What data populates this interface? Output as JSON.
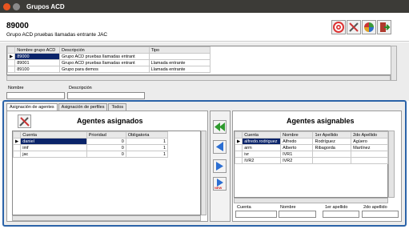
{
  "window": {
    "title": "Grupos ACD"
  },
  "header": {
    "code": "89000",
    "description": "Grupo ACD pruebas llamadas entrante JAC"
  },
  "groups_table": {
    "columns": [
      "Nombre grupo ACD",
      "Descripción",
      "Tipo"
    ],
    "rows": [
      [
        "89000",
        "Grupo ACD pruebas llamadas entrant",
        ""
      ],
      [
        "89001",
        "Grupo ACD pruebas llamadas entrant",
        "Llamada entrante"
      ],
      [
        "89100",
        "Grupo para demos",
        "Llamada entrante"
      ]
    ]
  },
  "filter": {
    "nombre_label": "Nombre",
    "descripcion_label": "Descripción"
  },
  "tabs": [
    "Asignación de agentes",
    "Asignación de perfiles",
    "Todos"
  ],
  "assigned": {
    "title": "Agentes asignados",
    "columns": [
      "Cuenta",
      "Prioridad",
      "Obligatoria"
    ],
    "rows": [
      [
        "daniel",
        "0",
        "1"
      ],
      [
        "imf",
        "0",
        "1"
      ],
      [
        "jac",
        "0",
        "1"
      ]
    ]
  },
  "assignable": {
    "title": "Agentes asignables",
    "columns": [
      "Cuenta",
      "Nombre",
      "1er Apellido",
      "2do Apellido"
    ],
    "rows": [
      [
        "alfredo.rodriguez",
        "Alfredo",
        "Rodríguez",
        "Agüero"
      ],
      [
        "arm",
        "Alberto",
        "Ribagorda",
        "Martínez"
      ],
      [
        "ivr",
        "IVR1",
        "",
        ""
      ],
      [
        "IVR2",
        "IVR2",
        "",
        ""
      ]
    ],
    "filter_labels": [
      "Cuenta",
      "Nombre",
      "1er apellido",
      "2do apellido"
    ]
  },
  "move_buttons": {
    "new_label": "NEW"
  },
  "colors": {
    "titlebar": "#3c3b37",
    "selection": "#0a246a",
    "panel_border": "#2b63a8"
  }
}
